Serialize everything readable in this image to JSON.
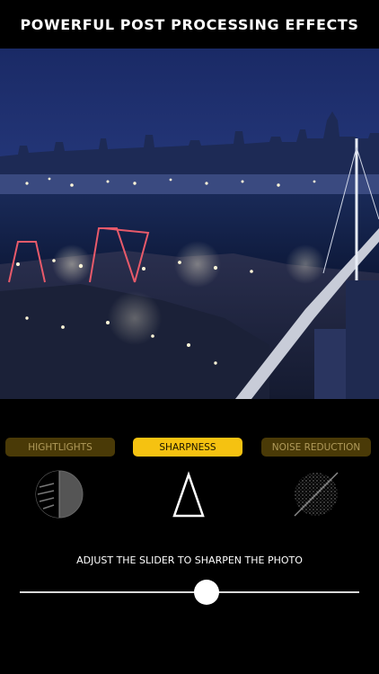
{
  "header": {
    "title": "POWERFUL POST PROCESSING EFFECTS"
  },
  "tabs": [
    {
      "label": "HIGHTLIGHTS",
      "active": false,
      "icon": "highlights-icon"
    },
    {
      "label": "SHARPNESS",
      "active": true,
      "icon": "sharpness-icon"
    },
    {
      "label": "NOISE REDUCTION",
      "active": false,
      "icon": "noise-reduction-icon"
    }
  ],
  "instruction": "ADJUST THE SLIDER TO SHARPEN THE PHOTO",
  "slider": {
    "value_fraction": 0.55
  },
  "colors": {
    "accent": "#f5c211",
    "inactive_tab": "#4a3a07",
    "inactive_tab_text": "#b09a5a",
    "background": "#000000"
  }
}
